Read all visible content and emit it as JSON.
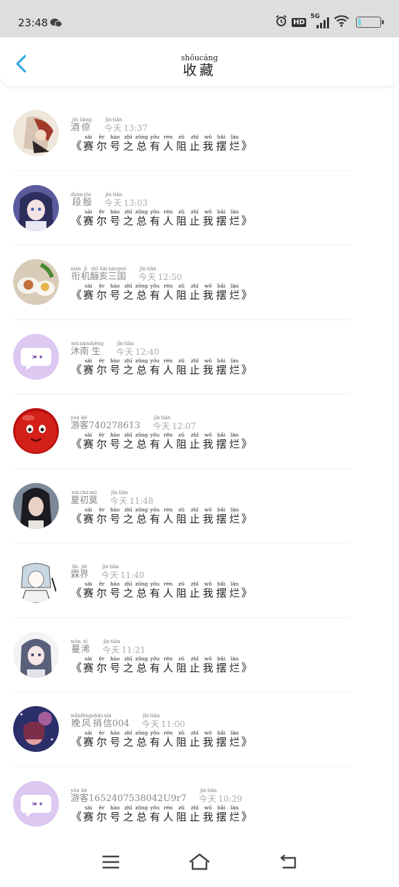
{
  "status_bar": {
    "time": "23:48",
    "network": "5G",
    "hd": "HD",
    "battery_level": 0.12,
    "icons": [
      "wechat-icon",
      "alarm-icon",
      "hd-icon",
      "signal-icon",
      "wifi-icon",
      "battery-icon"
    ]
  },
  "header": {
    "title": "收藏",
    "title_pinyin": "shōucáng",
    "back_icon": "chevron-left-icon",
    "accent_color": "#3aa9e6"
  },
  "favorite_title": {
    "open_bracket": "《",
    "close_bracket": "》",
    "chars": [
      {
        "hz": "赛",
        "py": "sài"
      },
      {
        "hz": "尔",
        "py": "ěr"
      },
      {
        "hz": "号",
        "py": "hào"
      },
      {
        "hz": "之",
        "py": "zhī"
      },
      {
        "hz": "总",
        "py": "zǒng"
      },
      {
        "hz": "有",
        "py": "yǒu"
      },
      {
        "hz": "人",
        "py": "rén"
      },
      {
        "hz": "阻",
        "py": "zǔ"
      },
      {
        "hz": "止",
        "py": "zhǐ"
      },
      {
        "hz": "我",
        "py": "wǒ"
      },
      {
        "hz": "摆",
        "py": "bǎi"
      },
      {
        "hz": "烂",
        "py": "làn"
      }
    ]
  },
  "items": [
    {
      "name_chars": [
        {
          "hz": "酒",
          "py": "jiǔ"
        },
        {
          "hz": "倞",
          "py": "liàng"
        }
      ],
      "name_suffix": "",
      "day_chars": [
        {
          "hz": "今",
          "py": "jīn"
        },
        {
          "hz": "天",
          "py": "tiān"
        }
      ],
      "time": "13:37",
      "avatar": "avatar-illustration-icon"
    },
    {
      "name_chars": [
        {
          "hz": "段",
          "py": "duàn"
        },
        {
          "hz": "殷",
          "py": "yīn"
        }
      ],
      "name_suffix": "",
      "day_chars": [
        {
          "hz": "今",
          "py": "jīn"
        },
        {
          "hz": "天",
          "py": "tiān"
        }
      ],
      "time": "13:03",
      "avatar": "avatar-anime-icon"
    },
    {
      "name_chars": [
        {
          "hz": "衔",
          "py": "xián"
        },
        {
          "hz": "机",
          "py": "jī"
        },
        {
          "hz": "酾",
          "py": "shī"
        },
        {
          "hz": "亥",
          "py": "hài"
        },
        {
          "hz": "三",
          "py": "sān"
        },
        {
          "hz": "国",
          "py": "guó"
        }
      ],
      "name_suffix": "",
      "day_chars": [
        {
          "hz": "今",
          "py": "jīn"
        },
        {
          "hz": "天",
          "py": "tiān"
        }
      ],
      "time": "12:50",
      "avatar": "avatar-food-icon"
    },
    {
      "name_chars": [
        {
          "hz": "沐",
          "py": "mù"
        },
        {
          "hz": "南",
          "py": "nán"
        },
        {
          "hz": "生",
          "py": "shēng"
        }
      ],
      "name_suffix": "",
      "day_chars": [
        {
          "hz": "今",
          "py": "jīn"
        },
        {
          "hz": "天",
          "py": "tiān"
        }
      ],
      "time": "12:40",
      "avatar": "avatar-default-chat-icon"
    },
    {
      "name_chars": [
        {
          "hz": "游",
          "py": "yóu"
        },
        {
          "hz": "客",
          "py": "kè"
        }
      ],
      "name_suffix": "740278613",
      "day_chars": [
        {
          "hz": "今",
          "py": "jīn"
        },
        {
          "hz": "天",
          "py": "tiān"
        }
      ],
      "time": "12:07",
      "avatar": "avatar-red-ball-icon"
    },
    {
      "name_chars": [
        {
          "hz": "夏",
          "py": "xià"
        },
        {
          "hz": "初",
          "py": "chū"
        },
        {
          "hz": "莫",
          "py": "mò"
        }
      ],
      "name_suffix": "",
      "day_chars": [
        {
          "hz": "今",
          "py": "jīn"
        },
        {
          "hz": "天",
          "py": "tiān"
        }
      ],
      "time": "11:48",
      "avatar": "avatar-portrait-icon"
    },
    {
      "name_chars": [
        {
          "hz": "霖",
          "py": "lín"
        },
        {
          "hz": "界",
          "py": "jiè"
        }
      ],
      "name_suffix": "",
      "day_chars": [
        {
          "hz": "今",
          "py": "jīn"
        },
        {
          "hz": "天",
          "py": "tiān"
        }
      ],
      "time": "11:40",
      "avatar": "avatar-sketch-icon"
    },
    {
      "name_chars": [
        {
          "hz": "蔓",
          "py": "wàn"
        },
        {
          "hz": "浠",
          "py": "xī"
        }
      ],
      "name_suffix": "",
      "day_chars": [
        {
          "hz": "今",
          "py": "jīn"
        },
        {
          "hz": "天",
          "py": "tiān"
        }
      ],
      "time": "11:21",
      "avatar": "avatar-anime-girl-icon"
    },
    {
      "name_chars": [
        {
          "hz": "晚",
          "py": "wǎn"
        },
        {
          "hz": "风",
          "py": "fēng"
        },
        {
          "hz": "捎",
          "py": "shāo"
        },
        {
          "hz": "信",
          "py": "xìn"
        }
      ],
      "name_suffix": "004",
      "day_chars": [
        {
          "hz": "今",
          "py": "jīn"
        },
        {
          "hz": "天",
          "py": "tiān"
        }
      ],
      "time": "11:00",
      "avatar": "avatar-night-icon"
    },
    {
      "name_chars": [
        {
          "hz": "游",
          "py": "yóu"
        },
        {
          "hz": "客",
          "py": "kè"
        }
      ],
      "name_suffix": "1652407538042U9r7",
      "day_chars": [
        {
          "hz": "今",
          "py": "jīn"
        },
        {
          "hz": "天",
          "py": "tiān"
        }
      ],
      "time": "10:29",
      "avatar": "avatar-default-chat-icon"
    }
  ],
  "nav_bar": {
    "icons": [
      "menu-icon",
      "home-icon",
      "back-icon"
    ]
  }
}
